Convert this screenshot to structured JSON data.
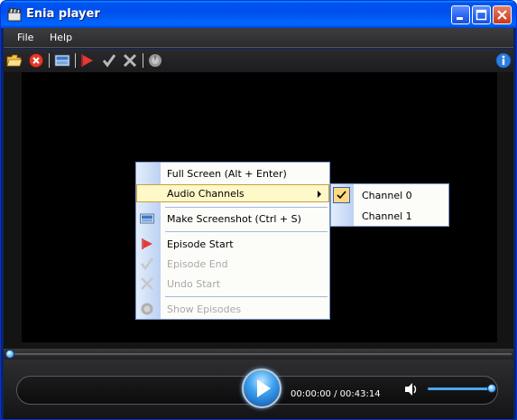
{
  "window": {
    "title": "Enia player",
    "icon": "film-clapper-icon"
  },
  "titlebar_buttons": [
    "minimize-icon",
    "maximize-icon",
    "close-icon"
  ],
  "menubar": {
    "items": [
      "File",
      "Help"
    ]
  },
  "toolbar": {
    "tools": [
      "open-folder-icon",
      "stop-icon",
      "screenshot-icon",
      "episode-start-icon",
      "episode-end-icon",
      "undo-start-icon",
      "show-episodes-icon"
    ],
    "info": "info-icon"
  },
  "context_menu": {
    "items": [
      {
        "label": "Full Screen (Alt + Enter)",
        "icon": "",
        "enabled": true
      },
      {
        "label": "Audio Channels",
        "icon": "",
        "enabled": true,
        "submenu": true,
        "highlighted": true
      },
      {
        "label": "Make Screenshot (Ctrl + S)",
        "icon": "screenshot-icon",
        "enabled": true
      },
      {
        "label": "Episode Start",
        "icon": "episode-start-icon",
        "enabled": true
      },
      {
        "label": "Episode End",
        "icon": "episode-end-icon",
        "enabled": false
      },
      {
        "label": "Undo Start",
        "icon": "undo-start-icon",
        "enabled": false
      },
      {
        "label": "Show Episodes",
        "icon": "show-episodes-icon",
        "enabled": false
      }
    ]
  },
  "audio_submenu": {
    "items": [
      {
        "label": "Channel 0",
        "checked": true
      },
      {
        "label": "Channel 1",
        "checked": false
      }
    ]
  },
  "playback": {
    "current_time": "00:00:00",
    "separator": " / ",
    "total_time": "00:43:14",
    "seek_fraction": 0.0,
    "volume_fraction": 0.95
  },
  "colors": {
    "titlebar": "#0053ee",
    "menu_highlight": "#fff8c8",
    "accent": "#3da2f0"
  }
}
